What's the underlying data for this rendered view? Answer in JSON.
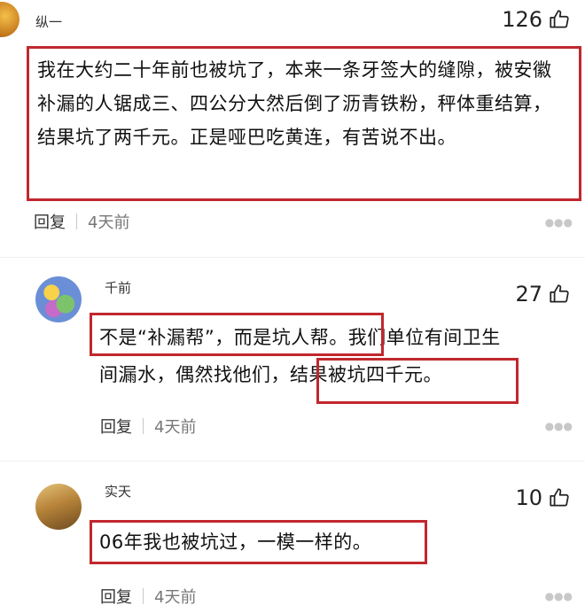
{
  "comments": [
    {
      "username": "纵一",
      "likes": "126",
      "text": "我在大约二十年前也被坑了，本来一条牙签大的缝隙，被安徽补漏的人锯成三、四公分大然后倒了沥青铁粉，秤体重结算，结果坑了两千元。正是哑巴吃黄连，有苦说不出。",
      "reply": "回复",
      "time": "4天前"
    },
    {
      "username": "千前",
      "likes": "27",
      "text_line1": "不是“补漏帮”，而是坑人帮。我们单位有间卫生",
      "text_line2": "间漏水，偶然找他们，结果被坑四千元。",
      "reply": "回复",
      "time": "4天前"
    },
    {
      "username": "实天",
      "likes": "10",
      "text": "06年我也被坑过，一模一样的。",
      "reply": "回复",
      "time": "4天前"
    }
  ],
  "icons": {
    "like": "thumbs-up-outline-icon",
    "more": "more-dots-icon"
  },
  "colors": {
    "highlight_box": "#c1272d",
    "text": "#111111",
    "meta": "#777777"
  }
}
